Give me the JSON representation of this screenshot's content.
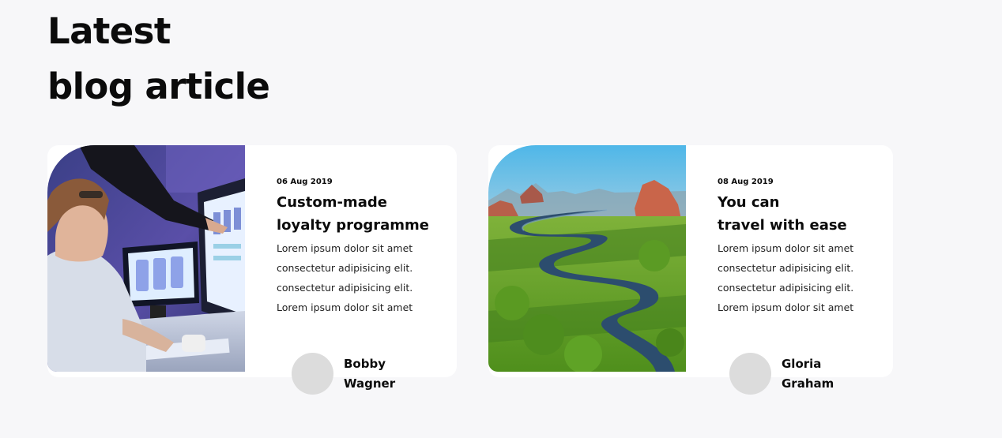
{
  "section": {
    "heading_line1": "Latest",
    "heading_line2": "blog article"
  },
  "articles": [
    {
      "date": "06 Aug 2019",
      "title_line1": "Custom-made",
      "title_line2": "loyalty programme",
      "excerpt_lines": [
        "Lorem ipsum dolor sit amet",
        "consectetur adipisicing elit.",
        "consectetur adipisicing elit.",
        "Lorem ipsum dolor sit amet"
      ],
      "author_first": "Bobby",
      "author_last": "Wagner",
      "image": "designer-at-computer-photo"
    },
    {
      "date": "08 Aug 2019",
      "title_line1": "You can",
      "title_line2": "travel with ease",
      "excerpt_lines": [
        "Lorem ipsum dolor sit amet",
        "consectetur adipisicing elit.",
        "consectetur adipisicing elit.",
        "Lorem ipsum dolor sit amet"
      ],
      "author_first": "Gloria",
      "author_last": "Graham",
      "image": "river-valley-aerial-photo"
    }
  ],
  "colors": {
    "page_background": "#f7f7f9",
    "card_background": "#ffffff",
    "text": "#0b0b0b",
    "avatar_placeholder": "#dcdcdc"
  }
}
